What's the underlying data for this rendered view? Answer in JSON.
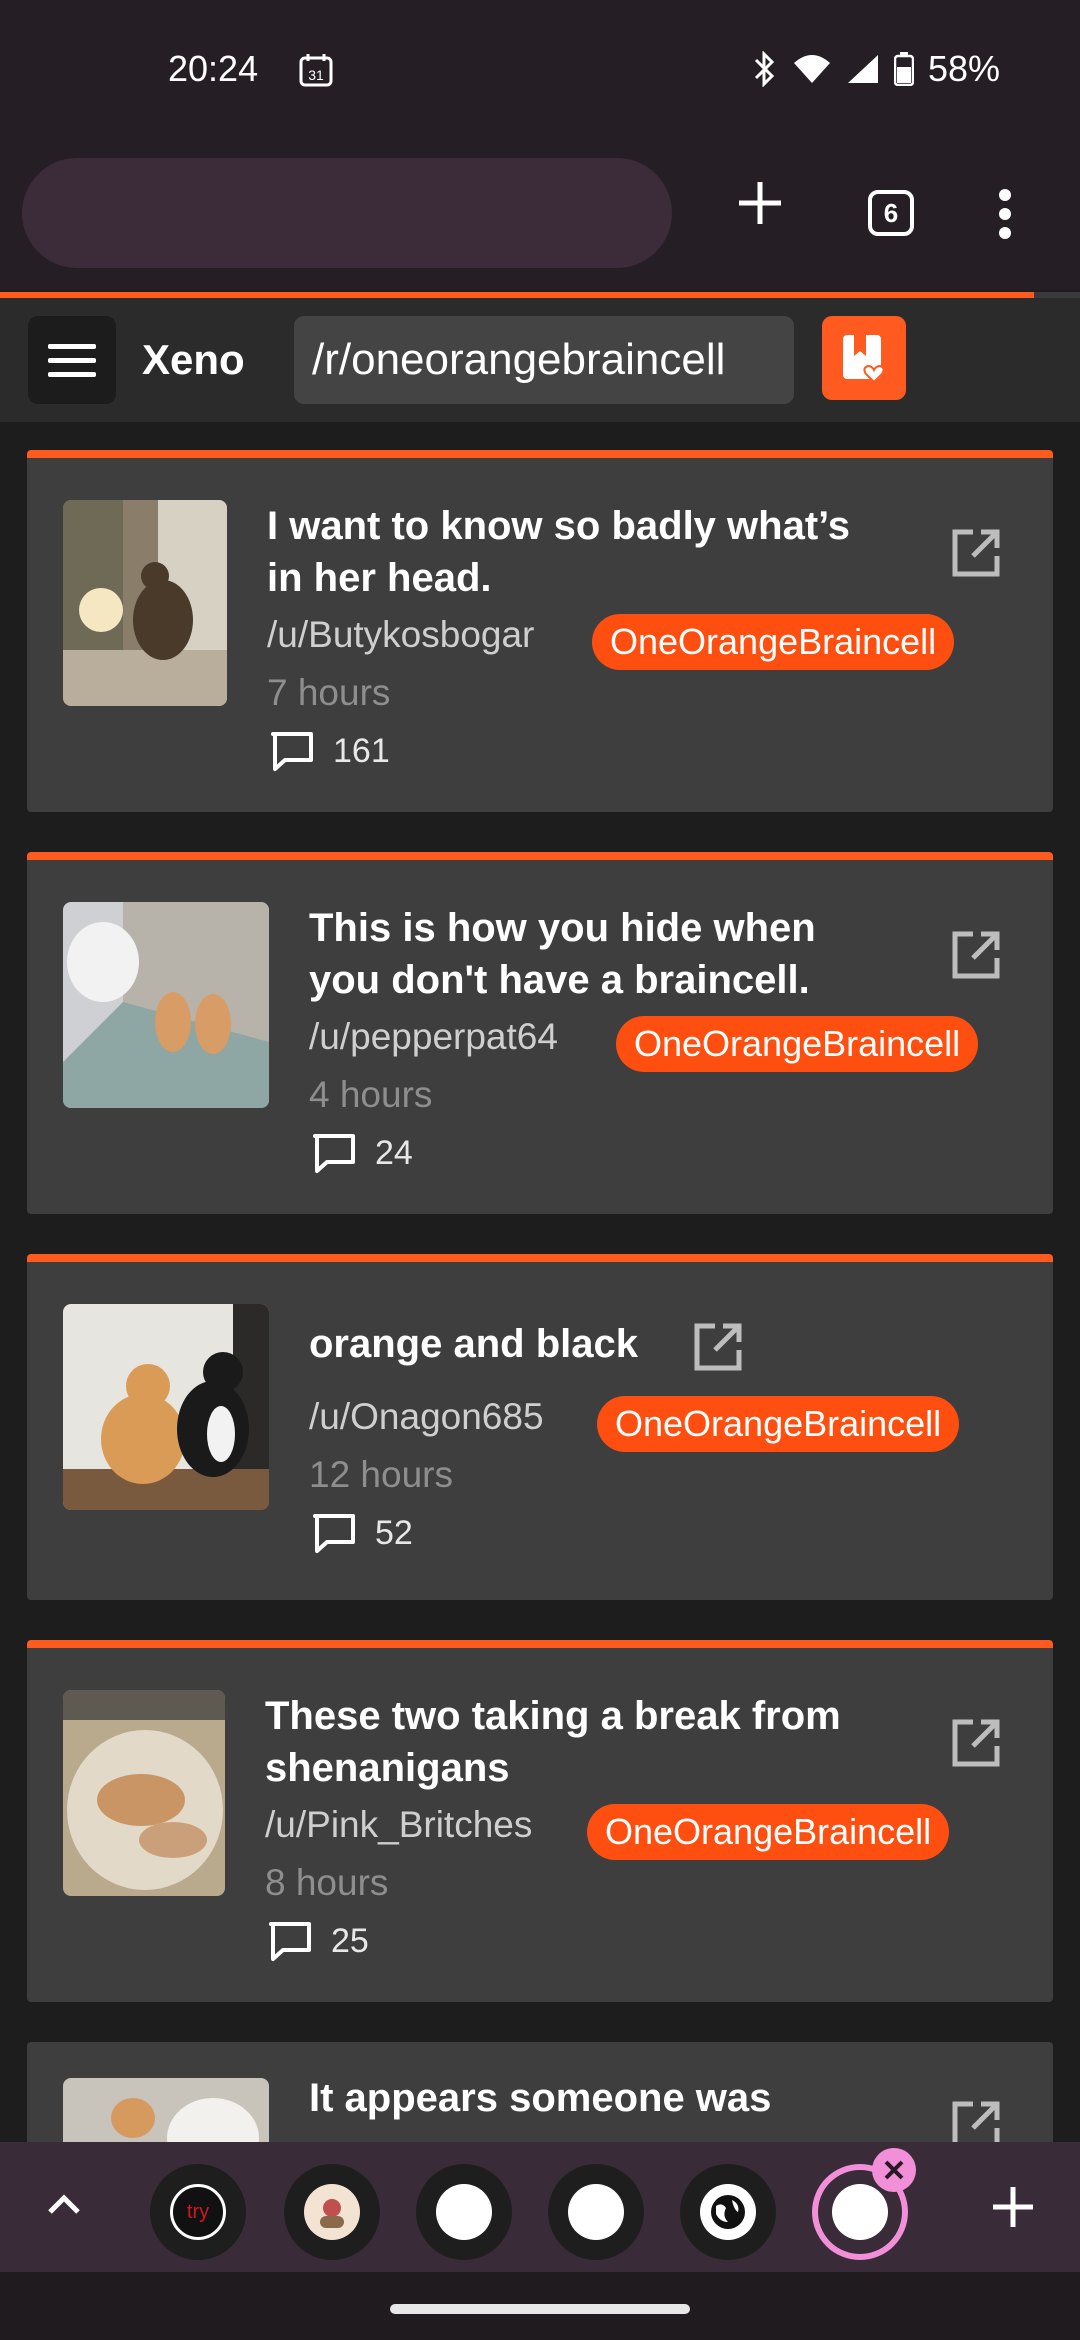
{
  "status_bar": {
    "time": "20:24",
    "calendar_day": "31",
    "battery": "58%"
  },
  "browser": {
    "tab_count": "6"
  },
  "app": {
    "brand": "Xeno",
    "subreddit_input": "/r/oneorangebraincell"
  },
  "posts": [
    {
      "title": "I want to know so badly what’s in her head.",
      "user": "/u/Butykosbogar",
      "flair": "OneOrangeBraincell",
      "time": "7 hours",
      "comments": "161"
    },
    {
      "title": "This is how you hide when you don't have a braincell.",
      "user": "/u/pepperpat64",
      "flair": "OneOrangeBraincell",
      "time": "4 hours",
      "comments": "24"
    },
    {
      "title": "orange and black",
      "user": "/u/Onagon685",
      "flair": "OneOrangeBraincell",
      "time": "12 hours",
      "comments": "52"
    },
    {
      "title": "These two taking a break from shenanigans",
      "user": "/u/Pink_Britches",
      "flair": "OneOrangeBraincell",
      "time": "8 hours",
      "comments": "25"
    },
    {
      "title": "It appears someone was"
    }
  ],
  "bottom_tabs": {
    "first_tab_label": "try"
  },
  "colors": {
    "accent": "#ff5a1f",
    "flair": "#ff4f10",
    "card": "#3e3e3e",
    "active_tab_ring": "#f18fd8"
  }
}
